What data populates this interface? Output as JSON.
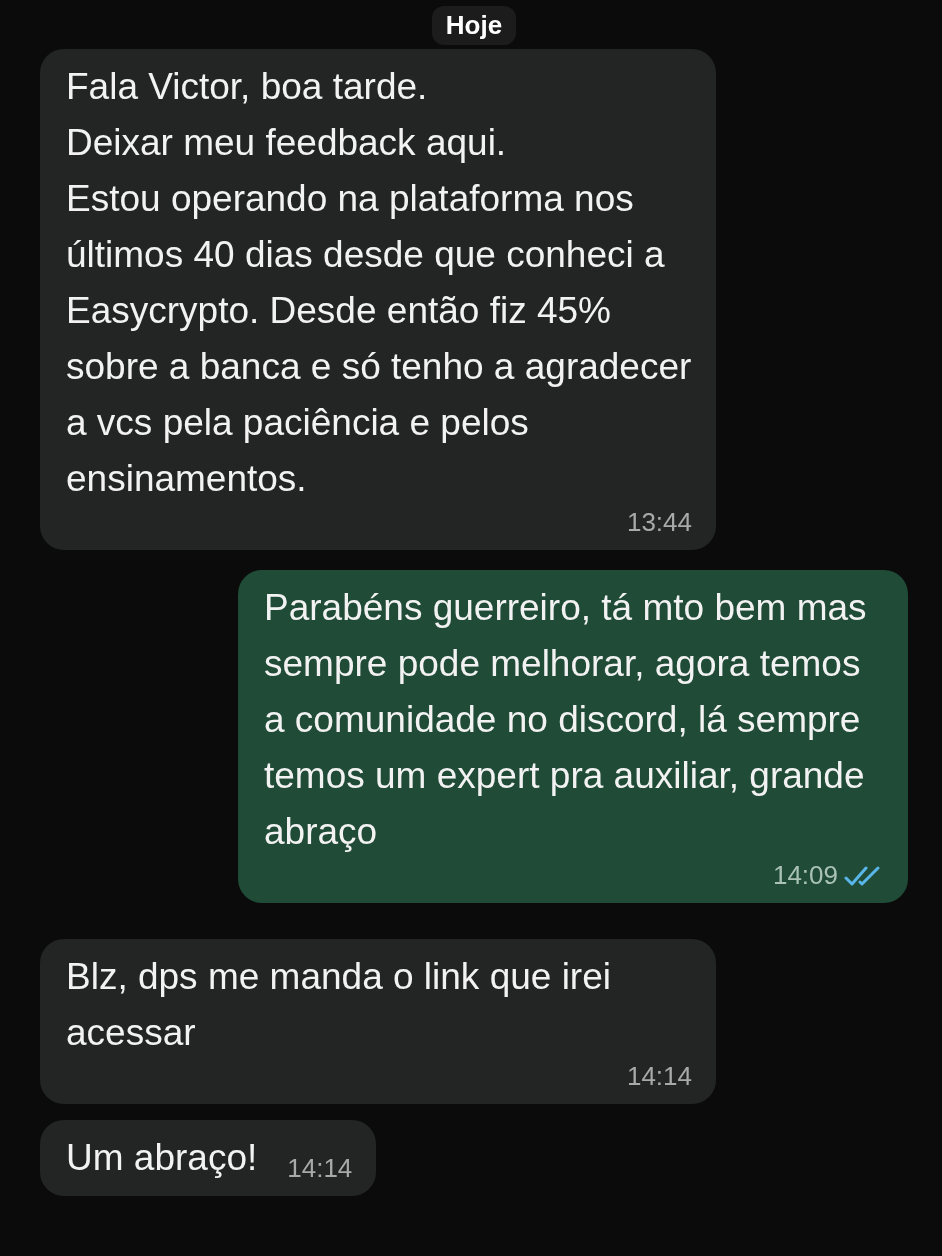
{
  "date_pill": "Hoje",
  "messages": [
    {
      "kind": "incoming",
      "text": "Fala Victor, boa tarde.\nDeixar meu feedback aqui.\nEstou operando na plataforma nos últimos 40 dias desde que conheci a Easycrypto. Desde então fiz 45% sobre a banca e só tenho a agradecer a vcs pela paciência e pelos ensinamentos.",
      "time": "13:44"
    },
    {
      "kind": "outgoing",
      "text": "Parabéns guerreiro, tá mto bem mas sempre pode melhorar, agora temos a comunidade no discord, lá sempre temos um expert pra auxiliar, grande abraço",
      "time": "14:09",
      "read": true
    },
    {
      "kind": "incoming",
      "text": "Blz, dps me manda o link que irei acessar",
      "time": "14:14"
    },
    {
      "kind": "incoming",
      "text": "Um abraço!",
      "time": "14:14"
    }
  ]
}
